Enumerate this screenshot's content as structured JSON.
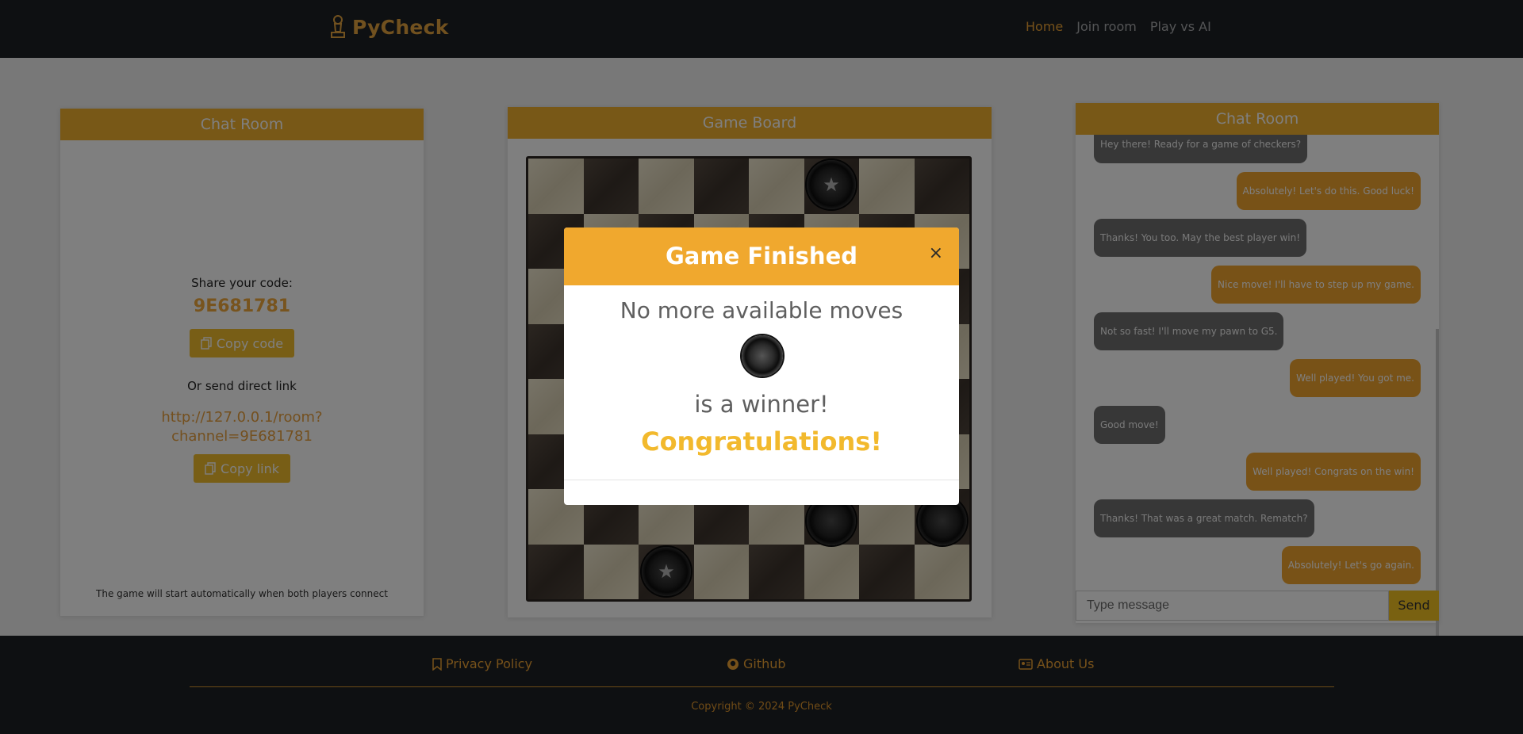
{
  "nav": {
    "brand": "PyCheck",
    "links": [
      "Home",
      "Join room",
      "Play vs AI"
    ]
  },
  "left_panel": {
    "title": "Chat Room",
    "share_label": "Share your code:",
    "code": "9E681781",
    "copy_code": "Copy code",
    "or_send": "Or send direct link",
    "link_line1": "http://127.0.0.1/room?",
    "link_line2": "channel=9E681781",
    "copy_link": "Copy link",
    "footnote": "The game will start automatically when both players connect"
  },
  "board_panel": {
    "title": "Game Board"
  },
  "chat": {
    "title": "Chat Room",
    "messages": [
      {
        "from": "them",
        "text": "Hey there! Ready for a game of checkers?"
      },
      {
        "from": "me",
        "text": "Absolutely! Let's do this. Good luck!"
      },
      {
        "from": "them",
        "text": "Thanks! You too. May the best player win!"
      },
      {
        "from": "me",
        "text": "Nice move! I'll have to step up my game."
      },
      {
        "from": "them",
        "text": "Not so fast! I'll move my pawn to G5."
      },
      {
        "from": "me",
        "text": "Well played! You got me."
      },
      {
        "from": "them",
        "text": "Good move!"
      },
      {
        "from": "me",
        "text": "Well played! Congrats on the win!"
      },
      {
        "from": "them",
        "text": "Thanks! That was a great match. Rematch?"
      },
      {
        "from": "me",
        "text": "Absolutely! Let's go again."
      }
    ],
    "input_placeholder": "Type message",
    "send": "Send"
  },
  "modal": {
    "title": "Game Finished",
    "close": "×",
    "message": "No more available moves",
    "winner_text": "is a winner!",
    "congrats": "Congratulations!"
  },
  "footer": {
    "privacy": "Privacy Policy",
    "github": "Github",
    "about": "About Us",
    "copyright": "Copyright © 2024 PyCheck"
  },
  "colors": {
    "accent": "#f0a82e",
    "nav_bg": "#1c2025"
  }
}
